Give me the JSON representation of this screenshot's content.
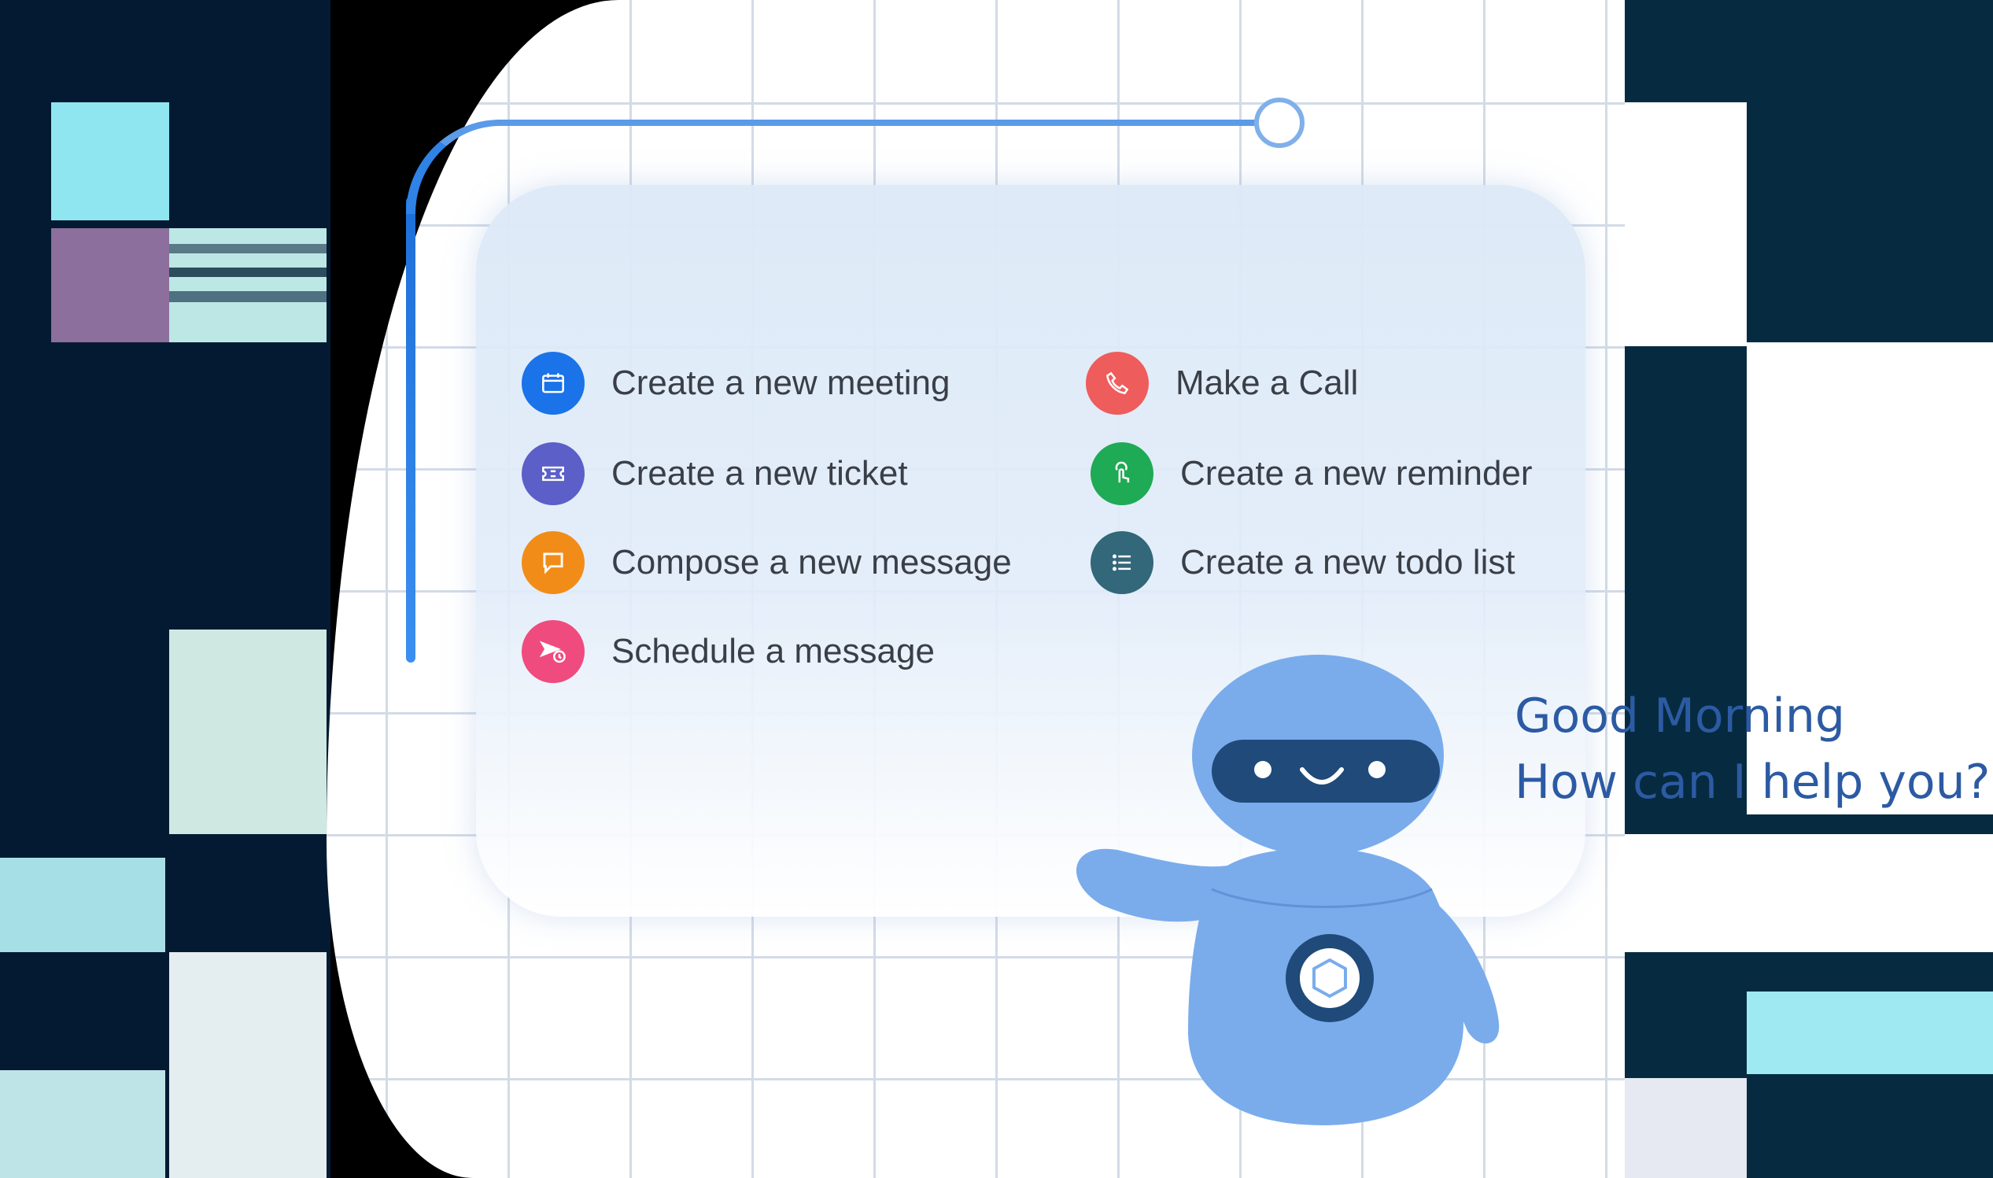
{
  "actions": [
    {
      "label": "Create a new meeting",
      "icon": "calendar-icon",
      "color": "#1a73e8"
    },
    {
      "label": "Create a new ticket",
      "icon": "ticket-icon",
      "color": "#5b5fc7"
    },
    {
      "label": "Compose a new message",
      "icon": "chat-bubble-icon",
      "color": "#f28c18"
    },
    {
      "label": "Schedule a message",
      "icon": "send-clock-icon",
      "color": "#ef4b7e"
    },
    {
      "label": "Make a Call",
      "icon": "phone-icon",
      "color": "#ee5c5c"
    },
    {
      "label": "Create a new reminder",
      "icon": "tap-icon",
      "color": "#1faa55"
    },
    {
      "label": "Create a new todo list",
      "icon": "list-icon",
      "color": "#33677a"
    }
  ],
  "greeting": {
    "line1": "Good Morning",
    "line2": "How can I help you?"
  },
  "colors": {
    "robot_body": "#7aacec",
    "robot_visor": "#1f4a7a",
    "greeting_text": "#2c5aa3",
    "connector": "#2f82e6"
  }
}
